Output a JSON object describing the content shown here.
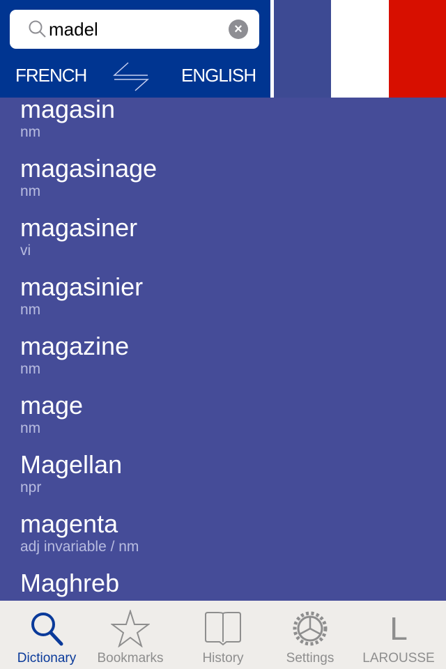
{
  "search": {
    "value": "madel"
  },
  "languages": {
    "source": "FRENCH",
    "target": "ENGLISH"
  },
  "colors": {
    "header": "#003591",
    "list_bg": "#454c98",
    "flag_blue": "#3d4a93",
    "flag_red": "#d70f00",
    "active_tab": "#0a3a9a"
  },
  "entries": [
    {
      "word": "magasin",
      "pos": "nm"
    },
    {
      "word": "magasinage",
      "pos": "nm"
    },
    {
      "word": "magasiner",
      "pos": "vi"
    },
    {
      "word": "magasinier",
      "pos": "nm"
    },
    {
      "word": "magazine",
      "pos": "nm"
    },
    {
      "word": "mage",
      "pos": "nm"
    },
    {
      "word": "Magellan",
      "pos": "npr"
    },
    {
      "word": "magenta",
      "pos": "adj invariable / nm"
    },
    {
      "word": "Maghreb",
      "pos": ""
    }
  ],
  "tabs": [
    {
      "label": "Dictionary",
      "icon": "search-icon",
      "active": true
    },
    {
      "label": "Bookmarks",
      "icon": "star-icon"
    },
    {
      "label": "History",
      "icon": "book-icon"
    },
    {
      "label": "Settings",
      "icon": "gear-icon"
    },
    {
      "label": "LAROUSSE",
      "icon": "larousse-l-icon"
    }
  ]
}
